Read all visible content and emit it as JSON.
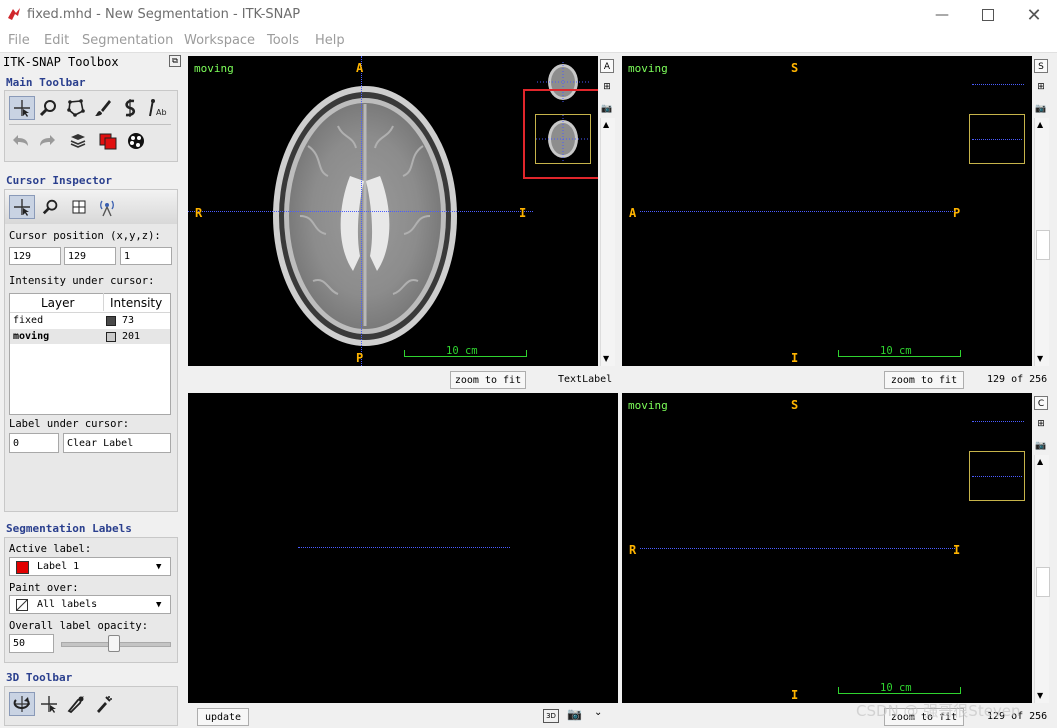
{
  "window": {
    "title": "fixed.mhd - New Segmentation - ITK-SNAP"
  },
  "menu": [
    "File",
    "Edit",
    "Segmentation",
    "Workspace",
    "Tools",
    "Help"
  ],
  "toolbox": {
    "title": "ITK-SNAP Toolbox",
    "main_toolbar_title": "Main Toolbar",
    "cursor_inspector_title": "Cursor Inspector",
    "cursor_position_label": "Cursor position (x,y,z):",
    "cursor_x": "129",
    "cursor_y": "129",
    "cursor_z": "1",
    "intensity_label": "Intensity under cursor:",
    "table": {
      "headers": [
        "Layer",
        "Intensity"
      ],
      "rows": [
        {
          "layer": "fixed",
          "value": "73",
          "swatch": "#494949"
        },
        {
          "layer": "moving",
          "value": "201",
          "swatch": "#c9c9c9"
        }
      ]
    },
    "label_under_cursor": "Label under cursor:",
    "label_id": "0",
    "label_name": "Clear Label",
    "segmentation_labels_title": "Segmentation Labels",
    "active_label_caption": "Active label:",
    "active_label": "Label 1",
    "active_label_color": "#e10000",
    "paint_over_caption": "Paint over:",
    "paint_over": "All labels",
    "opacity_caption": "Overall label opacity:",
    "opacity_value": "50",
    "toolbar3d_title": "3D Toolbar"
  },
  "views": {
    "axial": {
      "layer_name": "moving",
      "orient_top": "A",
      "orient_bottom": "P",
      "orient_left": "R",
      "orient_right": "I",
      "scale": "10 cm",
      "zoom_button": "zoom to fit",
      "footer_text": "TextLabel",
      "side_letter": "A"
    },
    "sagittal": {
      "layer_name": "moving",
      "orient_top": "S",
      "orient_bottom": "I",
      "orient_left": "A",
      "orient_right": "P",
      "scale": "10 cm",
      "zoom_button": "zoom to fit",
      "slice": "129 of 256",
      "side_letter": "S"
    },
    "coronal": {
      "layer_name": "moving",
      "orient_top": "S",
      "orient_bottom": "I",
      "orient_left": "R",
      "orient_right": "I",
      "scale": "10 cm",
      "zoom_button": "zoom to fit",
      "slice": "129 of 256",
      "side_letter": "C"
    },
    "three_d": {
      "update_button": "update",
      "badge_3d": "3D"
    }
  },
  "watermark": "CSDN @ 强哥很Steven",
  "colors": {
    "accent_title": "#2a3f8e",
    "orient": "#ffb400",
    "overlay_text": "#7dff5a",
    "highlight_box": "#e0262b"
  }
}
